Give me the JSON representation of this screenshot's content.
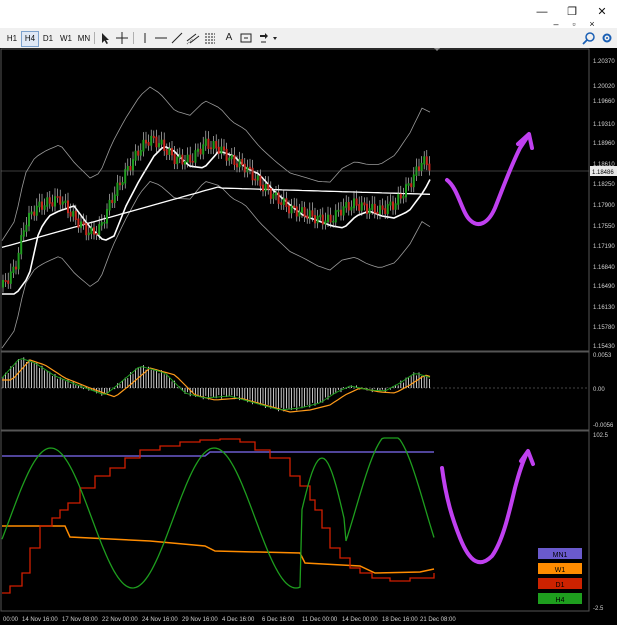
{
  "window": {
    "minimize_glyph": "—",
    "restore_glyph": "❐",
    "close_glyph": "✕",
    "menu_min_glyph": "–",
    "menu_restore_glyph": "▫",
    "menu_close_glyph": "×"
  },
  "toolbar": {
    "timeframes": [
      "H1",
      "H4",
      "D1",
      "W1",
      "MN"
    ],
    "active_timeframe": "H4",
    "text_tool_label": "A"
  },
  "price_axis": {
    "labels": [
      "1.20370",
      "1.20020",
      "1.19660",
      "1.19310",
      "1.18960",
      "1.18610",
      "1.18250",
      "1.17900",
      "1.17550",
      "1.17190",
      "1.16840",
      "1.16490",
      "1.16130",
      "1.15780",
      "1.15430"
    ],
    "current_price": "1.18486"
  },
  "macd_axis": {
    "top": "0.0053",
    "zero": "0.00",
    "bottom": "-0.0056"
  },
  "osc_axis": {
    "top": "102.5",
    "bottom": "-2.5"
  },
  "time_axis": [
    "00:00",
    "14 Nov 16:00",
    "17 Nov 08:00",
    "22 Nov 00:00",
    "24 Nov 16:00",
    "29 Nov 16:00",
    "4 Dec 16:00",
    "6 Dec 16:00",
    "11 Dec 00:00",
    "14 Dec 00:00",
    "18 Dec 16:00",
    "21 Dec 08:00"
  ],
  "legend": [
    {
      "label": "MN1",
      "color": "#6a5acd"
    },
    {
      "label": "W1",
      "color": "#ff8c00"
    },
    {
      "label": "D1",
      "color": "#cc2200"
    },
    {
      "label": "H4",
      "color": "#1e9e1e"
    }
  ],
  "colors": {
    "bull": "#1f9e1f",
    "bear": "#c8281f",
    "band": "#9a9a9a",
    "ma": "#ffffff",
    "annotation": "#c040f0",
    "macd_orange": "#ff9b1a",
    "osc_mn1": "#6a5acd",
    "osc_w1": "#ff8c00",
    "osc_d1": "#d01e00",
    "osc_h4": "#1e9e1e"
  }
}
